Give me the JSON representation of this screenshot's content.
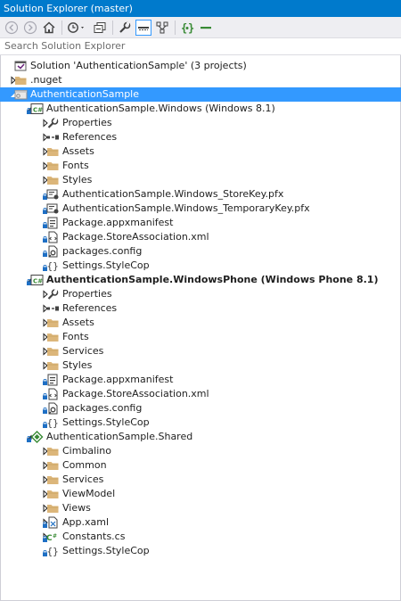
{
  "window": {
    "title": "Solution Explorer (master)"
  },
  "toolbar": {
    "buttons": [
      {
        "name": "back-icon",
        "active": false
      },
      {
        "name": "forward-icon",
        "active": false
      },
      {
        "name": "home-icon",
        "active": false
      },
      {
        "name": "history-icon",
        "active": false
      },
      {
        "name": "collapse-all-icon",
        "active": false
      },
      {
        "name": "properties-wrench-icon",
        "active": false
      },
      {
        "name": "show-all-files-icon",
        "active": true
      },
      {
        "name": "class-view-icon",
        "active": false
      },
      {
        "name": "sync-braces-icon",
        "active": false
      },
      {
        "name": "minus-icon",
        "active": false
      }
    ]
  },
  "search": {
    "placeholder": "Search Solution Explorer"
  },
  "tree": [
    {
      "label": "Solution 'AuthenticationSample' (3 projects)",
      "depth": 0,
      "expander": "none",
      "icon": "solution",
      "lock": false
    },
    {
      "label": ".nuget",
      "depth": 0,
      "expander": "collapsed",
      "icon": "folder",
      "lock": false
    },
    {
      "label": "AuthenticationSample",
      "depth": 0,
      "expander": "expanded",
      "icon": "web-project",
      "lock": false,
      "selected": true
    },
    {
      "label": "AuthenticationSample.Windows (Windows 8.1)",
      "depth": 1,
      "expander": "expanded",
      "icon": "cs-project",
      "lock": true
    },
    {
      "label": "Properties",
      "depth": 2,
      "expander": "collapsed",
      "icon": "wrench",
      "lock": false
    },
    {
      "label": "References",
      "depth": 2,
      "expander": "collapsed",
      "icon": "references",
      "lock": false
    },
    {
      "label": "Assets",
      "depth": 2,
      "expander": "collapsed",
      "icon": "folder",
      "lock": false
    },
    {
      "label": "Fonts",
      "depth": 2,
      "expander": "collapsed",
      "icon": "folder",
      "lock": false
    },
    {
      "label": "Styles",
      "depth": 2,
      "expander": "collapsed",
      "icon": "folder",
      "lock": false
    },
    {
      "label": "AuthenticationSample.Windows_StoreKey.pfx",
      "depth": 2,
      "expander": "none",
      "icon": "certificate",
      "lock": true
    },
    {
      "label": "AuthenticationSample.Windows_TemporaryKey.pfx",
      "depth": 2,
      "expander": "none",
      "icon": "certificate",
      "lock": true
    },
    {
      "label": "Package.appxmanifest",
      "depth": 2,
      "expander": "none",
      "icon": "manifest",
      "lock": true
    },
    {
      "label": "Package.StoreAssociation.xml",
      "depth": 2,
      "expander": "none",
      "icon": "xml",
      "lock": true
    },
    {
      "label": "packages.config",
      "depth": 2,
      "expander": "none",
      "icon": "config",
      "lock": true
    },
    {
      "label": "Settings.StyleCop",
      "depth": 2,
      "expander": "none",
      "icon": "braces",
      "lock": true
    },
    {
      "label": "AuthenticationSample.WindowsPhone (Windows Phone 8.1)",
      "depth": 1,
      "expander": "expanded",
      "icon": "cs-project",
      "lock": true,
      "bold": true
    },
    {
      "label": "Properties",
      "depth": 2,
      "expander": "collapsed",
      "icon": "wrench",
      "lock": false
    },
    {
      "label": "References",
      "depth": 2,
      "expander": "collapsed",
      "icon": "references",
      "lock": false
    },
    {
      "label": "Assets",
      "depth": 2,
      "expander": "collapsed",
      "icon": "folder",
      "lock": false
    },
    {
      "label": "Fonts",
      "depth": 2,
      "expander": "collapsed",
      "icon": "folder",
      "lock": false
    },
    {
      "label": "Services",
      "depth": 2,
      "expander": "collapsed",
      "icon": "folder",
      "lock": false
    },
    {
      "label": "Styles",
      "depth": 2,
      "expander": "collapsed",
      "icon": "folder",
      "lock": false
    },
    {
      "label": "Package.appxmanifest",
      "depth": 2,
      "expander": "none",
      "icon": "manifest",
      "lock": true
    },
    {
      "label": "Package.StoreAssociation.xml",
      "depth": 2,
      "expander": "none",
      "icon": "xml",
      "lock": true
    },
    {
      "label": "packages.config",
      "depth": 2,
      "expander": "none",
      "icon": "config",
      "lock": true
    },
    {
      "label": "Settings.StyleCop",
      "depth": 2,
      "expander": "none",
      "icon": "braces",
      "lock": true
    },
    {
      "label": "AuthenticationSample.Shared",
      "depth": 1,
      "expander": "expanded",
      "icon": "shared-project",
      "lock": true
    },
    {
      "label": "Cimbalino",
      "depth": 2,
      "expander": "collapsed",
      "icon": "folder",
      "lock": false
    },
    {
      "label": "Common",
      "depth": 2,
      "expander": "collapsed",
      "icon": "folder",
      "lock": false
    },
    {
      "label": "Services",
      "depth": 2,
      "expander": "collapsed",
      "icon": "folder",
      "lock": false
    },
    {
      "label": "ViewModel",
      "depth": 2,
      "expander": "collapsed",
      "icon": "folder",
      "lock": false
    },
    {
      "label": "Views",
      "depth": 2,
      "expander": "collapsed",
      "icon": "folder",
      "lock": false
    },
    {
      "label": "App.xaml",
      "depth": 2,
      "expander": "collapsed",
      "icon": "xaml",
      "lock": true
    },
    {
      "label": "Constants.cs",
      "depth": 2,
      "expander": "collapsed",
      "icon": "cs-file",
      "lock": true
    },
    {
      "label": "Settings.StyleCop",
      "depth": 2,
      "expander": "none",
      "icon": "braces",
      "lock": true
    }
  ],
  "colors": {
    "titlebar": "#007acc",
    "selection": "#3399ff",
    "folder": "#dcb67a",
    "lock": "#1e6fc4",
    "project_green": "#388a34"
  }
}
